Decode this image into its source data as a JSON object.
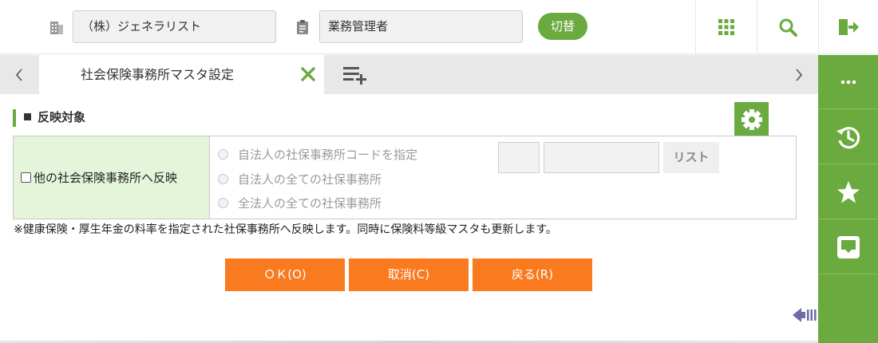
{
  "header": {
    "company_value": "（株）ジェネラリスト",
    "role_value": "業務管理者",
    "switch_label": "切替",
    "icons": [
      "building-icon",
      "clipboard-icon",
      "apps-grid-icon",
      "search-icon",
      "logout-icon"
    ]
  },
  "tabs": {
    "active_label": "社会保険事務所マスタ設定"
  },
  "sidebar": {
    "items": [
      "more-icon",
      "history-icon",
      "star-icon",
      "inbox-icon"
    ]
  },
  "section": {
    "title": "反映対象"
  },
  "reflect": {
    "checkbox_label": "他の社会保険事務所へ反映",
    "options": [
      "自法人の社保事務所コードを指定",
      "自法人の全ての社保事務所",
      "全法人の全ての社保事務所"
    ],
    "list_label": "リスト"
  },
  "note": "※健康保険・厚生年金の料率を指定された社保事務所へ反映します。同時に保険料等級マスタも更新します。",
  "actions": {
    "ok": "ＯＫ(O)",
    "cancel": "取消(C)",
    "back": "戻る(R)"
  },
  "colors": {
    "accent_green": "#6aaa3e",
    "action_orange": "#f97a1f",
    "panel_label_bg": "#e4f5da"
  }
}
